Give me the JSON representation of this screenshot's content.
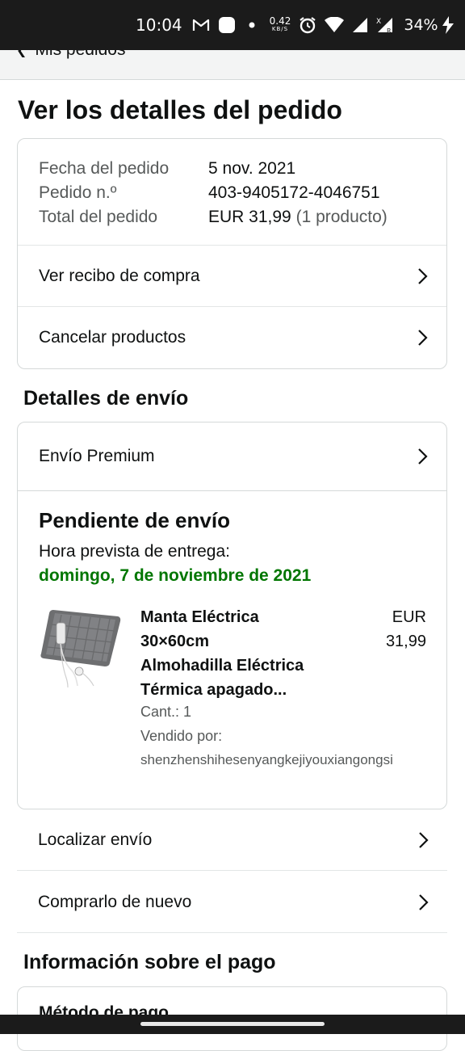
{
  "status_bar": {
    "time": "10:04",
    "net_speed_value": "0.42",
    "net_speed_unit": "KB/S",
    "battery": "34%",
    "icons": [
      "gmail-icon",
      "notification-icon",
      "dot-icon",
      "alarm-icon",
      "wifi-icon",
      "signal-icon",
      "signal-x-icon",
      "battery-charging-icon"
    ]
  },
  "header": {
    "back_label": "Mis pedidos"
  },
  "page_title": "Ver los detalles del pedido",
  "order_summary": {
    "rows": [
      {
        "label": "Fecha del pedido",
        "value": "5 nov. 2021"
      },
      {
        "label": "Pedido n.º",
        "value": "403-9405172-4046751"
      },
      {
        "label": "Total del pedido",
        "value": "EUR 31,99",
        "extra": "(1 producto)"
      }
    ],
    "links": [
      {
        "label": "Ver recibo de compra"
      },
      {
        "label": "Cancelar productos"
      }
    ]
  },
  "shipping": {
    "section_title": "Detalles de envío",
    "method": "Envío Premium",
    "status": "Pendiente de envío",
    "eta_label": "Hora prevista de entrega:",
    "eta_date": "domingo, 7 de noviembre de 2021",
    "accent_color": "#007600",
    "product": {
      "title_lines": [
        "Manta Eléctrica",
        "30×60cm",
        "Almohadilla Eléctrica",
        "Térmica apagado..."
      ],
      "price_currency": "EUR",
      "price_amount": "31,99",
      "qty": "Cant.: 1",
      "seller_label": "Vendido por:",
      "seller_name": "shenzhenshihesenyangkejiyouxiangongsi"
    }
  },
  "actions": [
    {
      "label": "Localizar envío"
    },
    {
      "label": "Comprarlo de nuevo"
    }
  ],
  "payment": {
    "section_title": "Información sobre el pago",
    "method_label": "Método de pago"
  }
}
